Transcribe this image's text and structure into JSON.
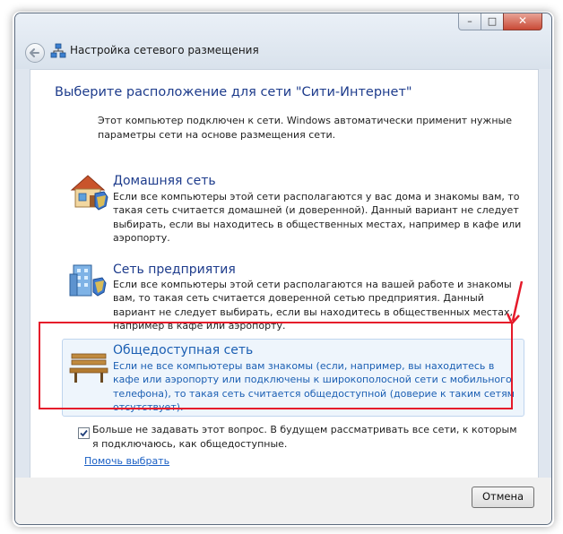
{
  "window": {
    "title": "Настройка сетевого размещения",
    "controls": {
      "minimize": "–",
      "maximize": "□",
      "close": "✕"
    }
  },
  "heading": "Выберите расположение для сети \"Сити-Интернет\"",
  "intro": "Этот компьютер подключен к сети. Windows автоматически применит нужные параметры сети на основе размещения сети.",
  "options": [
    {
      "title": "Домашняя сеть",
      "description": "Если все компьютеры этой сети располагаются у вас дома и знакомы вам, то такая сеть считается домашней (и доверенной). Данный вариант не следует выбирать, если вы находитесь в общественных местах, например в кафе или аэропорту.",
      "icon": "home-network-icon"
    },
    {
      "title": "Сеть предприятия",
      "description": "Если все компьютеры этой сети располагаются на вашей работе и знакомы вам, то такая сеть считается доверенной сетью предприятия. Данный вариант не следует выбирать, если вы находитесь в общественных местах, например в кафе или аэропорту.",
      "icon": "work-network-icon"
    },
    {
      "title": "Общедоступная сеть",
      "description": "Если не все компьютеры вам знакомы (если, например, вы находитесь в кафе или аэропорту или подключены к широкополосной сети с мобильного телефона), то такая сеть считается общедоступной (доверие к таким сетям отсутствует).",
      "icon": "bench-icon"
    }
  ],
  "checkbox": {
    "checked": true,
    "label": "Больше не задавать этот вопрос. В будущем рассматривать все сети, к которым я подключаюсь, как общедоступные."
  },
  "help_link": "Помочь выбрать",
  "buttons": {
    "cancel": "Отмена"
  },
  "colors": {
    "heading": "#1e3c8c",
    "link": "#1a5fc4",
    "highlight": "#e51a2a"
  }
}
